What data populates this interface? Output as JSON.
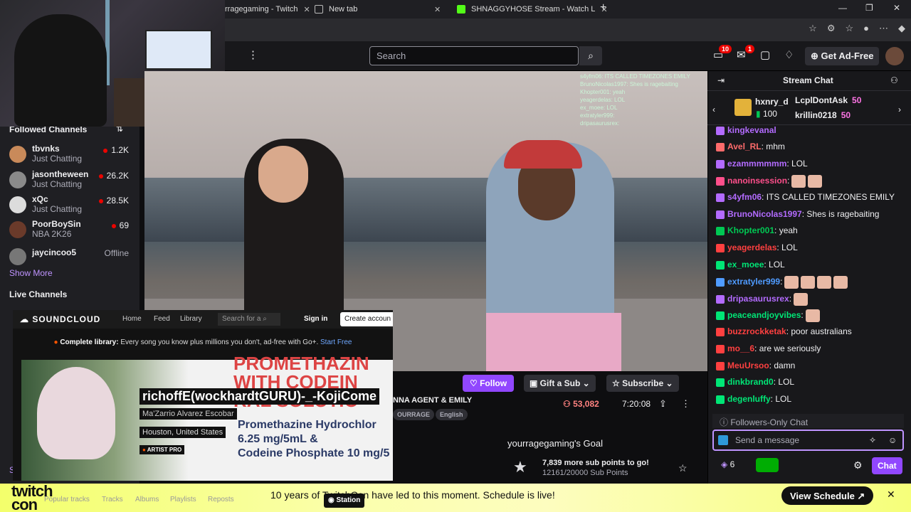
{
  "browser": {
    "tabs": [
      {
        "label": "rragegaming - Twitch"
      },
      {
        "label": "New tab"
      },
      {
        "label": "SHNAGGYHOSE Stream - Watch L"
      }
    ]
  },
  "topnav": {
    "search_placeholder": "Search",
    "notif_count": "10",
    "inbox_count": "1",
    "get_ad_free": "Get Ad-Free"
  },
  "sidebar": {
    "followed_heading": "Followed Channels",
    "channels": [
      {
        "name": "tbvnks",
        "game": "Just Chatting",
        "viewers": "1.2K",
        "avatar_color": "#c98a5a"
      },
      {
        "name": "jasontheween",
        "game": "Just Chatting",
        "viewers": "26.2K",
        "avatar_color": "#8a8a8a"
      },
      {
        "name": "xQc",
        "game": "Just Chatting",
        "viewers": "28.5K",
        "avatar_color": "#dcdcdc"
      },
      {
        "name": "PoorBoySin",
        "game": "NBA 2K26",
        "viewers": "69",
        "avatar_color": "#6a3a2a"
      },
      {
        "name": "jaycincoo5",
        "game": "",
        "viewers": "Offline",
        "avatar_color": "#777777"
      }
    ],
    "show_more": "Show More",
    "live_heading": "Live Channels",
    "truncated": "Sh"
  },
  "soundcloud": {
    "logo": "SOUNDCLOUD",
    "nav": [
      "Home",
      "Feed",
      "Library"
    ],
    "search_placeholder": "Search for a",
    "sign_in": "Sign in",
    "create_account": "Create accoun",
    "promo_bold": "Complete library:",
    "promo_text": " Every song you know plus millions you don't, ad-free with Go+. ",
    "promo_link": "Start Free",
    "track_title": "richoffE(wockhardtGURU)-_-KojiCome",
    "artist": "Ma'Zarrio Alvarez Escobar",
    "location": "Houston, United States",
    "artist_pro": "ARTIST PRO",
    "art_big_1": "PROMETHAZIN",
    "art_big_2": "WITH CODEIN",
    "art_big_3": "RAL SOLUTIO",
    "art_med_1": "Promethazine Hydrochlor",
    "art_med_2": "6.25 mg/5mL &",
    "art_med_3": "Codeine Phosphate 10 mg/5",
    "bottom_tabs": [
      "Popular tracks",
      "Tracks",
      "Albums",
      "Playlists",
      "Reposts"
    ],
    "station": "Station"
  },
  "stream": {
    "follow": "Follow",
    "gift_sub": "Gift a Sub",
    "subscribe": "Subscribe",
    "title": "NNA AGENT & EMILY",
    "tags": [
      "OURRAGE",
      "English"
    ],
    "viewers": "53,082",
    "uptime": "7:20:08",
    "goal_title": "yourragegaming's Goal",
    "goal_main": "7,839 more sub points to go!",
    "goal_sub": "12161/20000 Sub Points"
  },
  "video_chat_overlay": [
    "s4yfm06: ITS CALLED TIMEZONES EMILY",
    "BrunoNicolas1997: Shes is ragebaiting",
    "Khopter001: yeah",
    "yeagerdelas: LOL",
    "ex_moee: LOL",
    "extratyler999:",
    "dripasaurusrex:"
  ],
  "chat": {
    "title": "Stream Chat",
    "gifters": [
      {
        "name": "hxnry_d",
        "count": "100"
      },
      {
        "name": "LcplDontAsk",
        "count": "50"
      },
      {
        "name": "krillin0218",
        "count": "50"
      }
    ],
    "messages": [
      {
        "user": "kingkevanal",
        "text": "",
        "color": "#b36bff"
      },
      {
        "user": "Avel_RL",
        "text": ": mhm",
        "color": "#ff6b6b"
      },
      {
        "user": "ezammmmmm",
        "text": ": LOL",
        "color": "#b36bff"
      },
      {
        "user": "nanoinsession",
        "text": ":",
        "color": "#ff4f8b"
      },
      {
        "user": "s4yfm06",
        "text": ": ITS CALLED TIMEZONES EMILY",
        "color": "#b36bff"
      },
      {
        "user": "BrunoNicolas1997",
        "text": ": Shes is ragebaiting",
        "color": "#b36bff"
      },
      {
        "user": "Khopter001",
        "text": ": yeah",
        "color": "#00c853"
      },
      {
        "user": "yeagerdelas",
        "text": ": LOL",
        "color": "#ff4040"
      },
      {
        "user": "ex_moee",
        "text": ": LOL",
        "color": "#00e676"
      },
      {
        "user": "extratyler999",
        "text": ":",
        "color": "#4f9bff"
      },
      {
        "user": "dripasaurusrex",
        "text": ":",
        "color": "#b36bff"
      },
      {
        "user": "peaceandjoyvibes",
        "text": ":",
        "color": "#00e676"
      },
      {
        "user": "buzzrockketak",
        "text": ": poor australians",
        "color": "#ff4040"
      },
      {
        "user": "mo__6",
        "text": ": are we seriously",
        "color": "#ff4040"
      },
      {
        "user": "MeuUrsoo",
        "text": ": damn",
        "color": "#ff4040"
      },
      {
        "user": "dinkbrand0",
        "text": ": LOL",
        "color": "#00e676"
      },
      {
        "user": "degenluffy",
        "text": ": LOL",
        "color": "#00e676"
      }
    ],
    "followers_only": "Followers-Only Chat",
    "input_placeholder": "Send a message",
    "points": "6",
    "chat_button": "Chat"
  },
  "banner": {
    "logo_line1": "twitch",
    "logo_line2": "con",
    "text": "10 years of TwitchCon have led to this moment. Schedule is live!",
    "button": "View Schedule ↗"
  }
}
